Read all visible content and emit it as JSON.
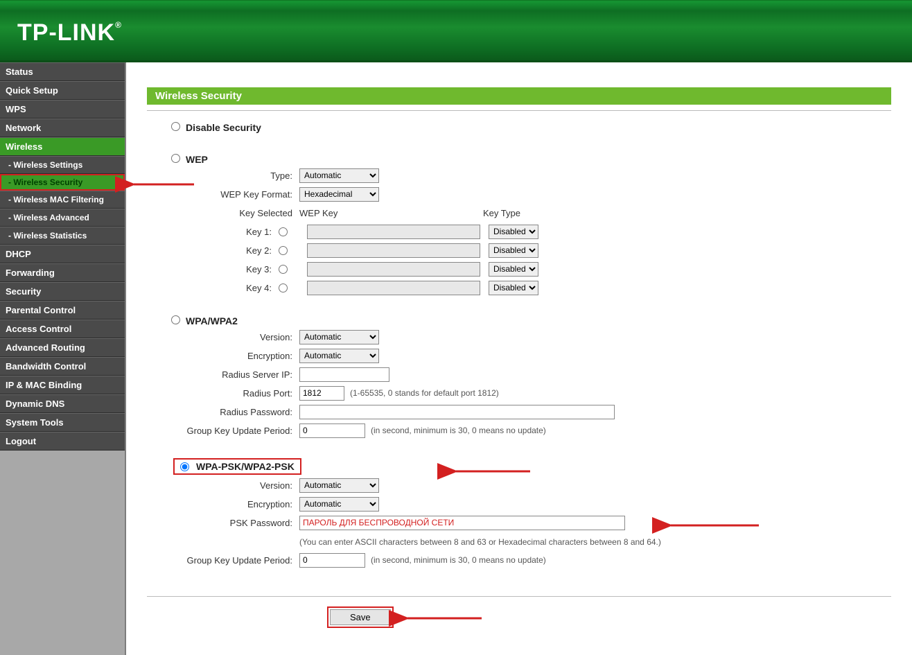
{
  "brand": "TP-LINK",
  "page_title": "Wireless Security",
  "nav": {
    "status": "Status",
    "quicksetup": "Quick Setup",
    "wps": "WPS",
    "network": "Network",
    "wireless": "Wireless",
    "wsettings": "- Wireless Settings",
    "wsecurity": "- Wireless Security",
    "wmac": "- Wireless MAC Filtering",
    "wadvanced": "- Wireless Advanced",
    "wstat": "- Wireless Statistics",
    "dhcp": "DHCP",
    "forwarding": "Forwarding",
    "security": "Security",
    "parental": "Parental Control",
    "access": "Access Control",
    "advrouting": "Advanced Routing",
    "bwcontrol": "Bandwidth Control",
    "ipmac": "IP & MAC Binding",
    "ddns": "Dynamic DNS",
    "systools": "System Tools",
    "logout": "Logout"
  },
  "sections": {
    "disable": "Disable Security",
    "wep": "WEP",
    "wpa": "WPA/WPA2",
    "wpapsk": "WPA-PSK/WPA2-PSK"
  },
  "labels": {
    "type": "Type:",
    "wepfmt": "WEP Key Format:",
    "keysel": "Key Selected",
    "wepkey": "WEP Key",
    "keytype": "Key Type",
    "key1": "Key 1:",
    "key2": "Key 2:",
    "key3": "Key 3:",
    "key4": "Key 4:",
    "version": "Version:",
    "encryption": "Encryption:",
    "radiusip": "Radius Server IP:",
    "radiusport": "Radius Port:",
    "radiuspwd": "Radius Password:",
    "gkup": "Group Key Update Period:",
    "pskpwd": "PSK Password:"
  },
  "values": {
    "wep_type": "Automatic",
    "wep_fmt": "Hexadecimal",
    "key_disabled": "Disabled",
    "wpa_version": "Automatic",
    "wpa_enc": "Automatic",
    "radius_ip": "",
    "radius_port": "1812",
    "radius_pwd": "",
    "wpa_gkup": "0",
    "psk_version": "Automatic",
    "psk_enc": "Automatic",
    "psk_pwd": "ПАРОЛЬ ДЛЯ БЕСПРОВОДНОЙ СЕТИ",
    "psk_gkup": "0"
  },
  "hints": {
    "radius_port": "(1-65535, 0 stands for default port 1812)",
    "gkup": "(in second, minimum is 30, 0 means no update)",
    "psk_note": "(You can enter ASCII characters between 8 and 63 or Hexadecimal characters between 8 and 64.)"
  },
  "buttons": {
    "save": "Save"
  }
}
